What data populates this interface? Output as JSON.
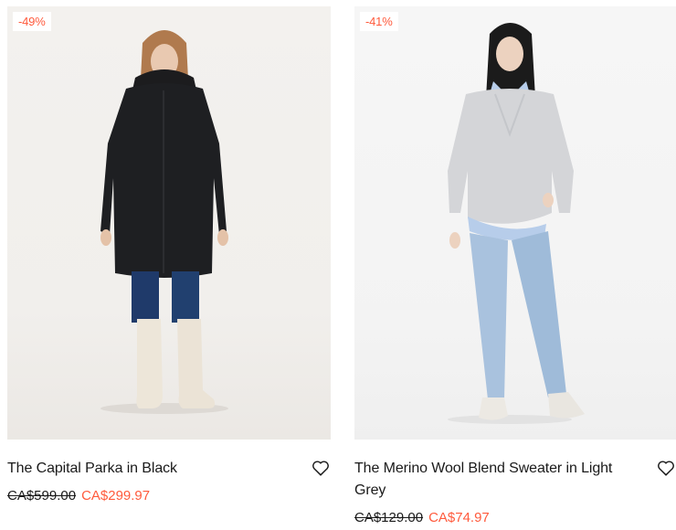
{
  "products": [
    {
      "badge": "-49%",
      "title": "The Capital Parka in Black",
      "old_price": "CA$599.00",
      "sale_price": "CA$299.97"
    },
    {
      "badge": "-41%",
      "title": "The Merino Wool Blend Sweater in Light Grey",
      "old_price": "CA$129.00",
      "sale_price": "CA$74.97"
    }
  ],
  "colors": {
    "sale": "#ff5a3c",
    "text": "#1a1a1a"
  },
  "icons": {
    "wishlist": "heart-outline-icon"
  }
}
